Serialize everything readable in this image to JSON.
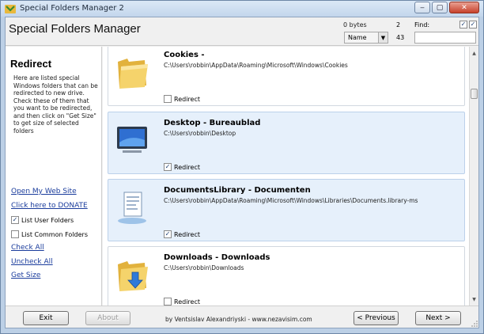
{
  "window": {
    "title": "Special Folders Manager 2",
    "min": "‒",
    "max": "▢",
    "close": "✕"
  },
  "header": {
    "app_title": "Special Folders Manager",
    "bytes": "0 bytes",
    "count_top": "2",
    "count_bottom": "43",
    "find_label": "Find:",
    "find_value": "",
    "find_check1": "✓",
    "find_check2": "✓",
    "sort_value": "Name",
    "sort_arrow": "▼"
  },
  "left": {
    "title": "Redirect",
    "description": "Here are listed special Windows folders that can be redirected to new drive. Check these of them that you want to be redirected, and then click on \"Get Size\" to get size of selected folders",
    "link_web": "Open My Web Site",
    "link_donate": "Click here to DONATE",
    "list_user": "List User Folders",
    "list_user_mark": "✓",
    "list_common": "List Common Folders",
    "list_common_mark": "",
    "check_all": "Check All",
    "uncheck_all": "Uncheck All",
    "get_size": "Get Size"
  },
  "folders": [
    {
      "name": "Cookies -",
      "path": "C:\\Users\\robbin\\AppData\\Roaming\\Microsoft\\Windows\\Cookies",
      "redirect": "Redirect",
      "mark": "",
      "icon": "folder-icon"
    },
    {
      "name": "Desktop - Bureaublad",
      "path": "C:\\Users\\robbin\\Desktop",
      "redirect": "Redirect",
      "mark": "✓",
      "icon": "desktop-monitor-icon"
    },
    {
      "name": "DocumentsLibrary - Documenten",
      "path": "C:\\Users\\robbin\\AppData\\Roaming\\Microsoft\\Windows\\Libraries\\Documents.library-ms",
      "redirect": "Redirect",
      "mark": "✓",
      "icon": "documents-library-icon"
    },
    {
      "name": "Downloads - Downloads",
      "path": "C:\\Users\\robbin\\Downloads",
      "redirect": "Redirect",
      "mark": "",
      "icon": "downloads-folder-icon"
    }
  ],
  "scroll": {
    "up": "▲",
    "down": "▼"
  },
  "footer": {
    "exit": "Exit",
    "about": "About",
    "credit": "by Ventsislav Alexandriyski - www.nezavisim.com",
    "previous": "< Previous",
    "next": "Next >"
  },
  "colors": {
    "selected_row": "#e6f0fb",
    "link": "#1a3c9c",
    "folder": "#f2c94c"
  }
}
